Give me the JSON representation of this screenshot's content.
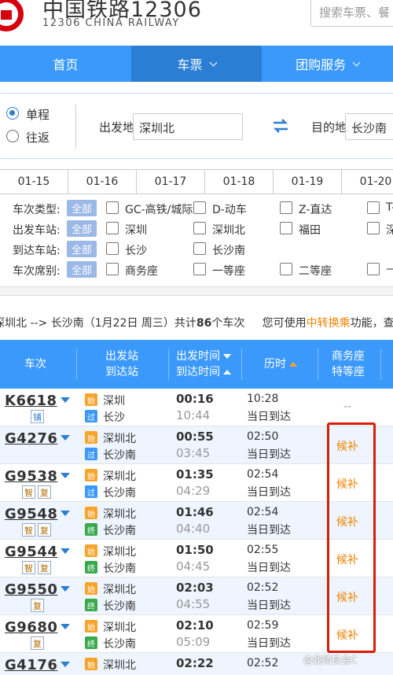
{
  "header": {
    "brand_cn": "中国铁路12306",
    "brand_en": "12306 CHINA RAILWAY",
    "search_placeholder": "搜索车票、餐"
  },
  "nav": {
    "items": [
      "首页",
      "车票",
      "团购服务"
    ]
  },
  "query": {
    "trip_types": [
      "单程",
      "往返"
    ],
    "from_label": "出发地",
    "from_value": "深圳北",
    "to_label": "目的地",
    "to_value": "长沙南"
  },
  "dates": [
    "01-15",
    "01-16",
    "01-17",
    "01-18",
    "01-19",
    "01-20"
  ],
  "filters": [
    {
      "title": "车次类型:",
      "all": "全部",
      "options": [
        "GC-高铁/城际",
        "D-动车",
        "Z-直达",
        "T-"
      ]
    },
    {
      "title": "出发车站:",
      "all": "全部",
      "options": [
        "深圳",
        "深圳北",
        "福田",
        "深"
      ]
    },
    {
      "title": "到达车站:",
      "all": "全部",
      "options": [
        "长沙",
        "长沙南"
      ]
    },
    {
      "title": "车次席别:",
      "all": "全部",
      "options": [
        "商务座",
        "一等座",
        "二等座",
        "—"
      ]
    }
  ],
  "summary": {
    "route": "深圳北 --> 长沙南（1月22日 周三）共计",
    "count": "86",
    "unit": "个车次",
    "hint_pre": "您可使用",
    "hint_link": "中转换乘",
    "hint_post": "功能，查"
  },
  "table": {
    "col_train": "车次",
    "col_station": [
      "出发站",
      "到达站"
    ],
    "col_time": [
      "出发时间",
      "到达时间"
    ],
    "col_duration": "历时",
    "col_seat": [
      "商务座",
      "特等座"
    ],
    "rows": [
      {
        "train": "K6618",
        "tags": [
          "铺"
        ],
        "from_icon": "始",
        "from": "深圳",
        "to_icon": "过",
        "to": "长沙",
        "dep": "00:16",
        "arr": "10:44",
        "dur": "10:28",
        "arrive_day": "当日到达",
        "seat": "--"
      },
      {
        "train": "G4276",
        "tags": [],
        "from_icon": "始",
        "from": "深圳北",
        "to_icon": "过",
        "to": "长沙南",
        "dep": "00:55",
        "arr": "03:45",
        "dur": "02:50",
        "arrive_day": "当日到达",
        "seat": "候补"
      },
      {
        "train": "G9538",
        "tags": [
          "智",
          "复"
        ],
        "from_icon": "始",
        "from": "深圳北",
        "to_icon": "过",
        "to": "长沙南",
        "dep": "01:35",
        "arr": "04:29",
        "dur": "02:54",
        "arrive_day": "当日到达",
        "seat": "候补"
      },
      {
        "train": "G9548",
        "tags": [
          "智",
          "复"
        ],
        "from_icon": "始",
        "from": "深圳北",
        "to_icon": "终",
        "to": "长沙南",
        "dep": "01:46",
        "arr": "04:40",
        "dur": "02:54",
        "arrive_day": "当日到达",
        "seat": "候补"
      },
      {
        "train": "G9544",
        "tags": [
          "智",
          "复"
        ],
        "from_icon": "始",
        "from": "深圳北",
        "to_icon": "终",
        "to": "长沙南",
        "dep": "01:50",
        "arr": "04:45",
        "dur": "02:55",
        "arrive_day": "当日到达",
        "seat": "候补"
      },
      {
        "train": "G9550",
        "tags": [
          "复"
        ],
        "from_icon": "始",
        "from": "深圳北",
        "to_icon": "终",
        "to": "长沙南",
        "dep": "02:03",
        "arr": "04:55",
        "dur": "02:52",
        "arrive_day": "当日到达",
        "seat": "候补"
      },
      {
        "train": "G9680",
        "tags": [
          "复"
        ],
        "from_icon": "始",
        "from": "深圳北",
        "to_icon": "终",
        "to": "长沙南",
        "dep": "02:10",
        "arr": "05:09",
        "dur": "02:59",
        "arrive_day": "当日到达",
        "seat": "候补"
      },
      {
        "train": "G4176",
        "tags": [],
        "from_icon": "始",
        "from": "深圳北",
        "to_icon": "",
        "to": "",
        "dep": "02:22",
        "arr": "",
        "dur": "02:52",
        "arrive_day": "",
        "seat": ""
      }
    ]
  },
  "watermark": "@我睛良会C",
  "colors": {
    "nav": "#3b99fc",
    "nav_active": "#2b7ed3",
    "standby": "#f08300",
    "highlight_box": "#d81e06"
  }
}
